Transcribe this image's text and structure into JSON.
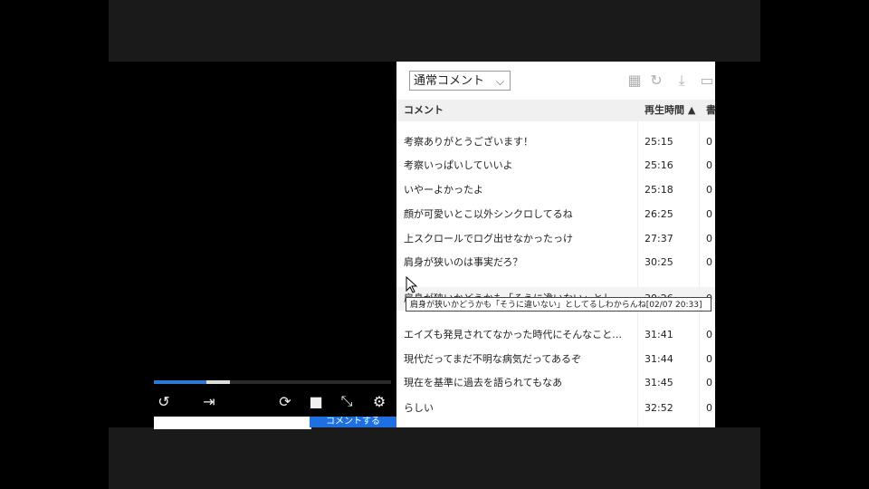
{
  "player": {
    "progress_played": 0.22,
    "progress_buffered_start": 0.22,
    "progress_buffered_end": 0.32,
    "controls": [
      {
        "name": "rewind-icon",
        "glyph": "↺"
      },
      {
        "name": "skip-icon",
        "glyph": "⇥"
      },
      {
        "name": "loop-icon",
        "glyph": "⟳"
      },
      {
        "name": "comment-toggle-icon",
        "glyph": "■"
      },
      {
        "name": "fullscreen-icon",
        "glyph": "⤡"
      },
      {
        "name": "settings-icon",
        "glyph": "⚙"
      }
    ],
    "comment_submit_label": "コメントする"
  },
  "panel": {
    "filter_select": "通常コメント",
    "header": {
      "comment": "コメント",
      "time": "再生時間 ▲",
      "extra": "書"
    },
    "rows": [
      {
        "comment": "考察ありがとうございます！",
        "time": "25:15",
        "extra": "0"
      },
      {
        "comment": "考察いっぱいしていいよ",
        "time": "25:16",
        "extra": "0"
      },
      {
        "comment": "いやーよかったよ",
        "time": "25:18",
        "extra": "0"
      },
      {
        "comment": "顔が可愛いとこ以外シンクロしてるね",
        "time": "26:25",
        "extra": "0"
      },
      {
        "comment": "上スクロールでログ出せなかったっけ",
        "time": "27:37",
        "extra": "0"
      },
      {
        "comment": "肩身が狭いのは事実だろ？",
        "time": "30:25",
        "extra": "0"
      },
      {
        "comment": "肩身が狭いかどうかも「そうに違いない」とし…",
        "time": "30:26",
        "extra": "0"
      },
      {
        "comment": "エイズも発見されてなかった時代にそんなこと…",
        "time": "31:41",
        "extra": "0"
      },
      {
        "comment": "現代だってまだ不明な病気だってあるぞ",
        "time": "31:44",
        "extra": "0"
      },
      {
        "comment": "現在を基準に過去を語られてもなあ",
        "time": "31:45",
        "extra": "0"
      },
      {
        "comment": "らしい",
        "time": "32:52",
        "extra": "0"
      }
    ],
    "tooltip": "肩身が狭いかどうかも「そうに違いない」としてるしわからんね[02/07 20:33]"
  }
}
